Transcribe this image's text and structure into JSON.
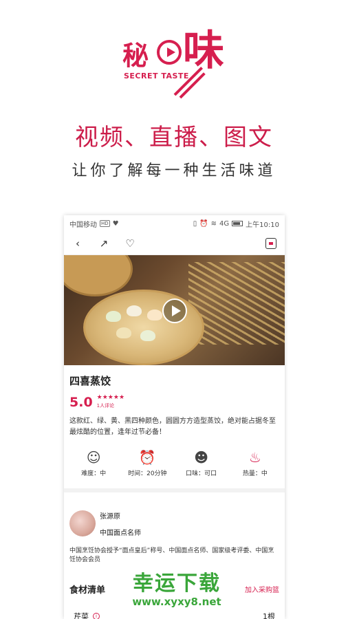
{
  "promo": {
    "logo_char1": "秘",
    "logo_char2": "味",
    "logo_en": "SECRET TASTE",
    "headline": "视频、直播、图文",
    "tagline": "让你了解每一种生活味道"
  },
  "status_bar": {
    "carrier": "中国移动",
    "hd": "HD",
    "network": "4G",
    "time": "上午10:10"
  },
  "recipe": {
    "title": "四喜蒸饺",
    "score": "5.0",
    "stars": "★★★★★",
    "reviews": "1人评论",
    "description": "这款红、绿、黄、黑四种颜色，圆圆方方造型蒸饺，绝对能占据冬至最炫酷的位置，逢年过节必备！",
    "attributes": [
      {
        "icon": "chef-hat-icon",
        "label": "难度：中"
      },
      {
        "icon": "clock-icon",
        "label": "时间：20分钟"
      },
      {
        "icon": "taste-icon",
        "label": "口味：可口"
      },
      {
        "icon": "flame-icon",
        "label": "热量：中"
      }
    ]
  },
  "chef": {
    "name": "张源原",
    "title": "中国面点名师",
    "bio": "中国烹饪协会授予“面点皇后”称号、中国面点名师、国家级考评委、中国烹饪协会会员"
  },
  "ingredients": {
    "title": "食材清单",
    "cart_label": "加入采购篮",
    "items": [
      {
        "name": "芹菜",
        "qty": "1根"
      }
    ]
  },
  "watermark": {
    "cn": "幸运下载",
    "url": "www.xyxy8.net"
  },
  "colors": {
    "brand": "#d61f4f",
    "watermark": "#3aa63a"
  }
}
